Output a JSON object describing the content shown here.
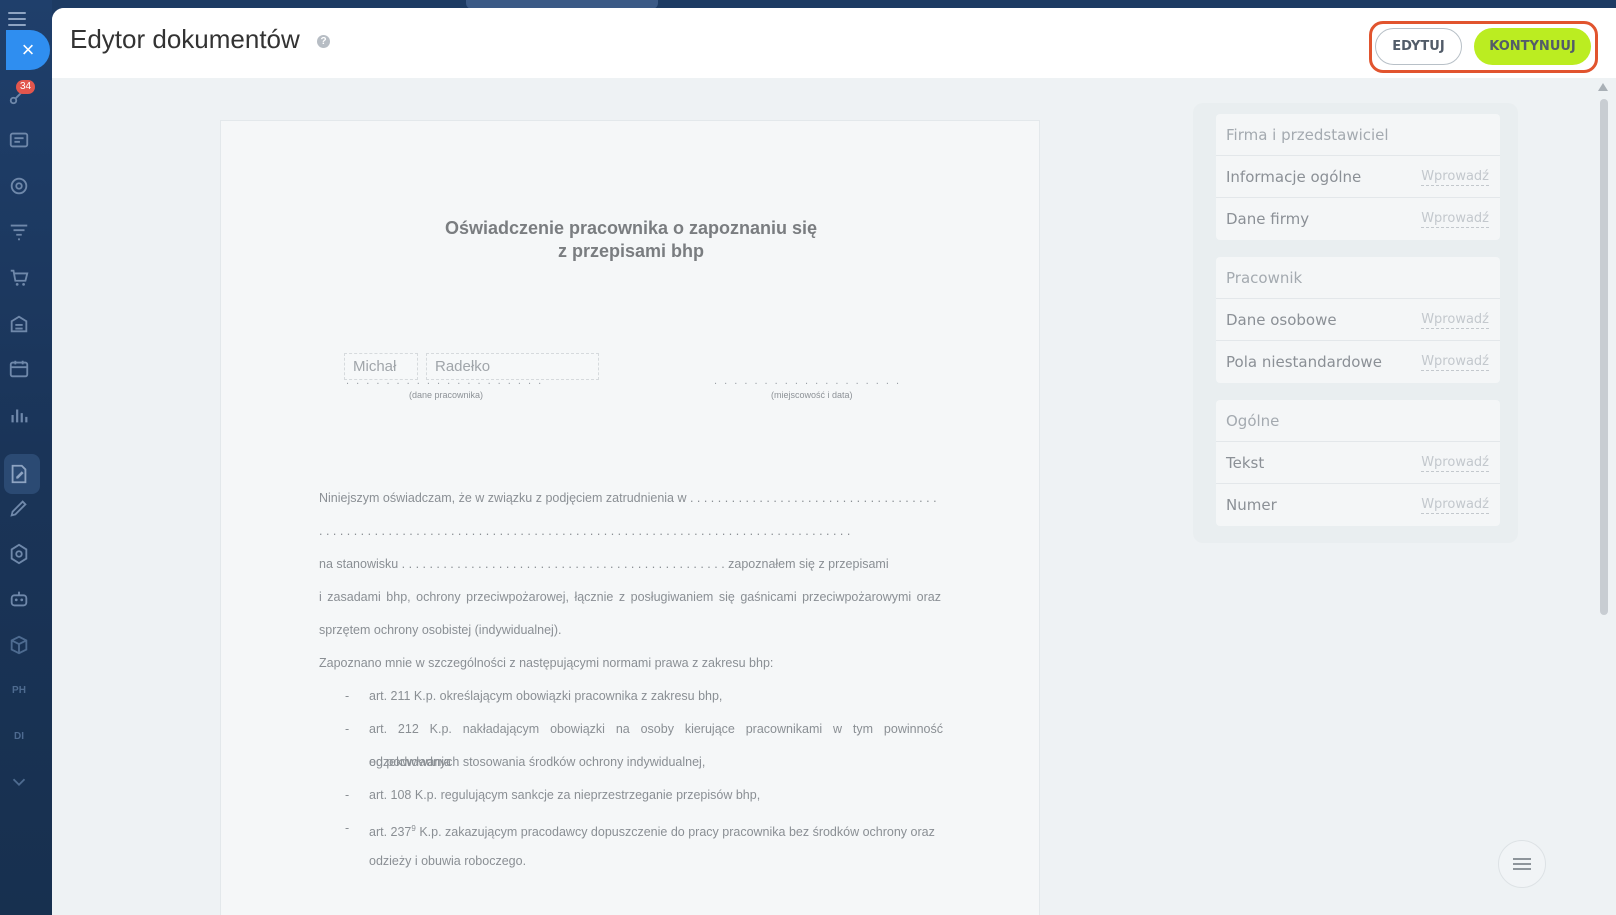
{
  "header": {
    "title": "Edytor dokumentów",
    "help_icon": "?",
    "edit_label": "EDYTUJ",
    "continue_label": "KONTYNUUJ"
  },
  "sidebar": {
    "close_icon": "×",
    "badge": "34",
    "icons": [
      "menu-icon",
      "close-icon",
      "activity-icon",
      "crm-card-icon",
      "target-icon",
      "funnel-icon",
      "cart-icon",
      "store-icon",
      "calendar-icon",
      "analytics-icon",
      "document-sign-icon",
      "pen-icon",
      "hexagon-icon",
      "robot-icon",
      "cube-icon",
      "ph-text-icon",
      "di-text-icon",
      "chevron-down-icon"
    ],
    "text_icons": [
      "PH",
      "DI"
    ]
  },
  "document": {
    "title_line1": "Oświadczenie pracownika o zapoznaniu się",
    "title_line2": "z przepisami bhp",
    "first_name": "Michał",
    "last_name": "Radełko",
    "employee_caption": "(dane pracownika)",
    "place_caption": "(miejscowość i data)",
    "para1": "Niniejszym oświadczam, że w związku z podjęciem zatrudnienia w . . . . . . . . . . . . . . . . . . . . . . . . . . . . . . . . . . . .",
    "para1_dots": ". . . . . . . . . . . . . . . . . . . . . . . . . . . . . . . . . . . . . . . . . . . . . . . . . . . . . . . . . . . . . . . . . . . . . . . . . . . . .",
    "para2_a": "na stanowisku . . . . . . . . . . . . . . . . . . . . . . . . . . . . . . . . . . . . . . . . . . . . . . .   zapoznałem się z przepisami",
    "para2_b": "i zasadami bhp, ochrony przeciwpożarowej, łącznie z posługiwaniem się gaśnicami przeciwpożarowymi oraz",
    "para2_c": "sprzętem ochrony osobistej (indywidualnej).",
    "para3": "Zapoznano mnie w szczególności z następującymi normami prawa z zakresu bhp:",
    "items": [
      {
        "dash": "-",
        "line1": "art. 211 K.p. określającym obowiązki pracownika z zakresu bhp,",
        "line2": ""
      },
      {
        "dash": "-",
        "line1": "art. 212 K.p. nakładającym obowiązki na osoby kierujące pracownikami w tym powinność egzekwowania",
        "line2": "od podwładnych stosowania środków ochrony indywidualnej,"
      },
      {
        "dash": "-",
        "line1": "art. 108 K.p. regulującym sankcje za nieprzestrzeganie przepisów bhp,",
        "line2": ""
      },
      {
        "dash": "-",
        "line1_pre": "art. 237",
        "line1_sup": "9",
        "line1_post": " K.p. zakazującym pracodawcy dopuszczenie do pracy pracownika bez środków ochrony oraz",
        "line2": "odzieży i obuwia roboczego."
      }
    ]
  },
  "fields_panel": {
    "groups": [
      {
        "title": "Firma i przedstawiciel",
        "rows": [
          {
            "label": "Informacje ogólne",
            "action": "Wprowadź"
          },
          {
            "label": "Dane firmy",
            "action": "Wprowadź"
          }
        ]
      },
      {
        "title": "Pracownik",
        "rows": [
          {
            "label": "Dane osobowe",
            "action": "Wprowadź"
          },
          {
            "label": "Pola niestandardowe",
            "action": "Wprowadź"
          }
        ]
      },
      {
        "title": "Ogólne",
        "rows": [
          {
            "label": "Tekst",
            "action": "Wprowadź"
          },
          {
            "label": "Numer",
            "action": "Wprowadź"
          }
        ]
      }
    ]
  },
  "colors": {
    "accent_blue": "#2f8ef0",
    "continue_green": "#bbed21",
    "highlight_red": "#e1542e",
    "badge_red": "#e2564d"
  }
}
